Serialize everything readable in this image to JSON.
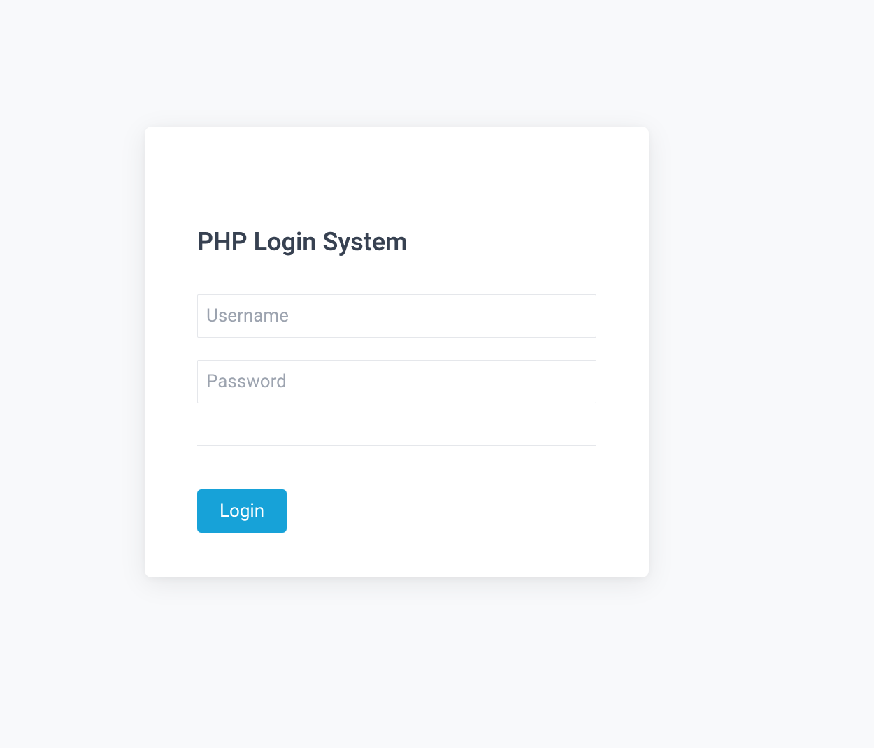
{
  "form": {
    "title": "PHP Login System",
    "username": {
      "placeholder": "Username",
      "value": ""
    },
    "password": {
      "placeholder": "Password",
      "value": ""
    },
    "submit_label": "Login"
  },
  "colors": {
    "accent": "#17a2d8",
    "background": "#f8f9fb",
    "card": "#ffffff",
    "text": "#374151",
    "placeholder": "#9ca3af",
    "border": "#e5e7eb"
  }
}
